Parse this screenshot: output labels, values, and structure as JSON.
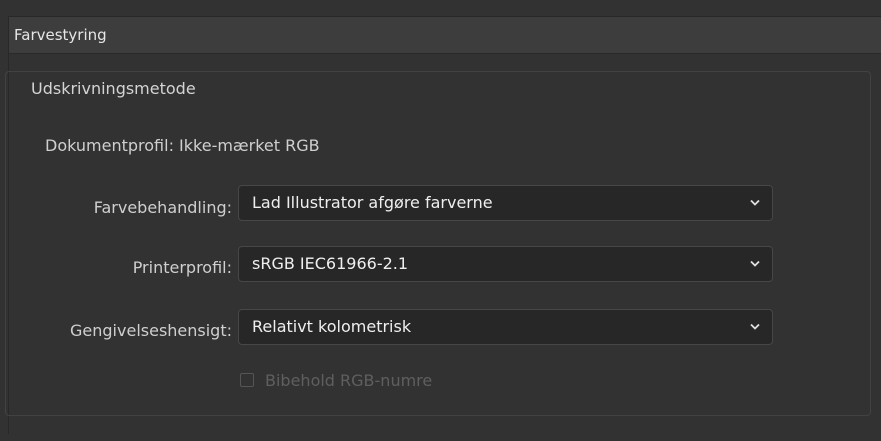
{
  "panel": {
    "title": "Farvestyring"
  },
  "group": {
    "label": "Udskrivningsmetode",
    "document_profile": "Dokumentprofil: Ikke-mærket RGB"
  },
  "rows": [
    {
      "label": "Farvebehandling:",
      "value": "Lad Illustrator afgøre farverne",
      "icon": "chevron-down-icon"
    },
    {
      "label": "Printerprofil:",
      "value": "sRGB IEC61966-2.1",
      "icon": "chevron-down-icon"
    },
    {
      "label": "Gengivelseshensigt:",
      "value": "Relativt kolometrisk",
      "icon": "chevron-down-icon"
    }
  ],
  "checkbox": {
    "label": "Bibehold RGB-numre",
    "checked": false,
    "enabled": false
  }
}
